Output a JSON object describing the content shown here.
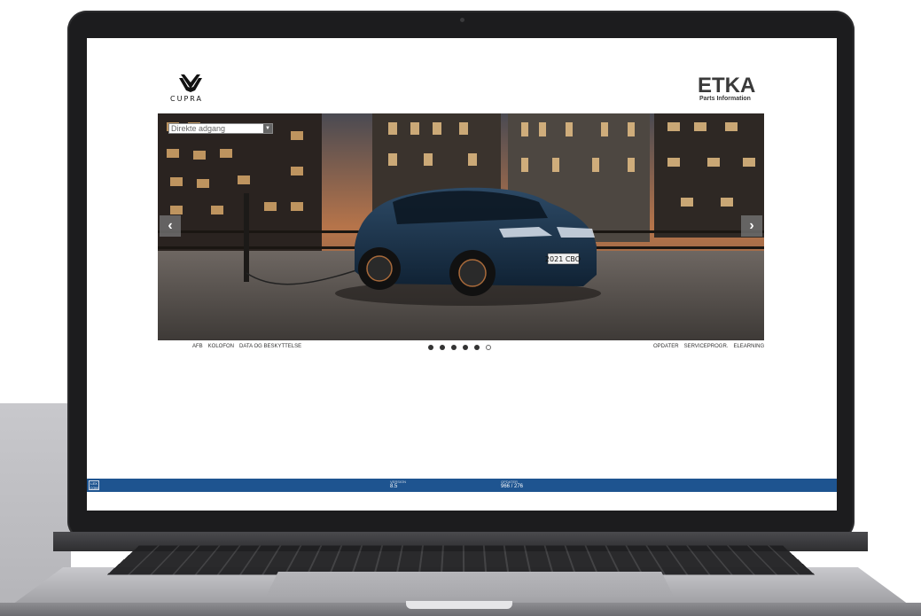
{
  "brand": {
    "logo_text": "CUPRA"
  },
  "etka": {
    "title": "ETKA",
    "subtitle": "Parts Information"
  },
  "direct_access": {
    "value": "Direkte adgang"
  },
  "carousel": {
    "plate": "2021 CBO",
    "prev_icon": "chevron-left-icon",
    "next_icon": "chevron-right-icon",
    "dots_total": 6,
    "active_dot": 6
  },
  "footer_links_left": [
    "AFB",
    "KOLOFON",
    "DATA OG BESKYTTELSE"
  ],
  "footer_links_right": [
    "OPDATER",
    "SERVICEPROGR.",
    "ELEARNING"
  ],
  "statusbar": {
    "logo": "LEX COM",
    "version_label": "VERSION",
    "version_value": "8.5",
    "update_label": "OPDATER",
    "update_value": "966 / 276",
    "color": "#1e5490"
  }
}
